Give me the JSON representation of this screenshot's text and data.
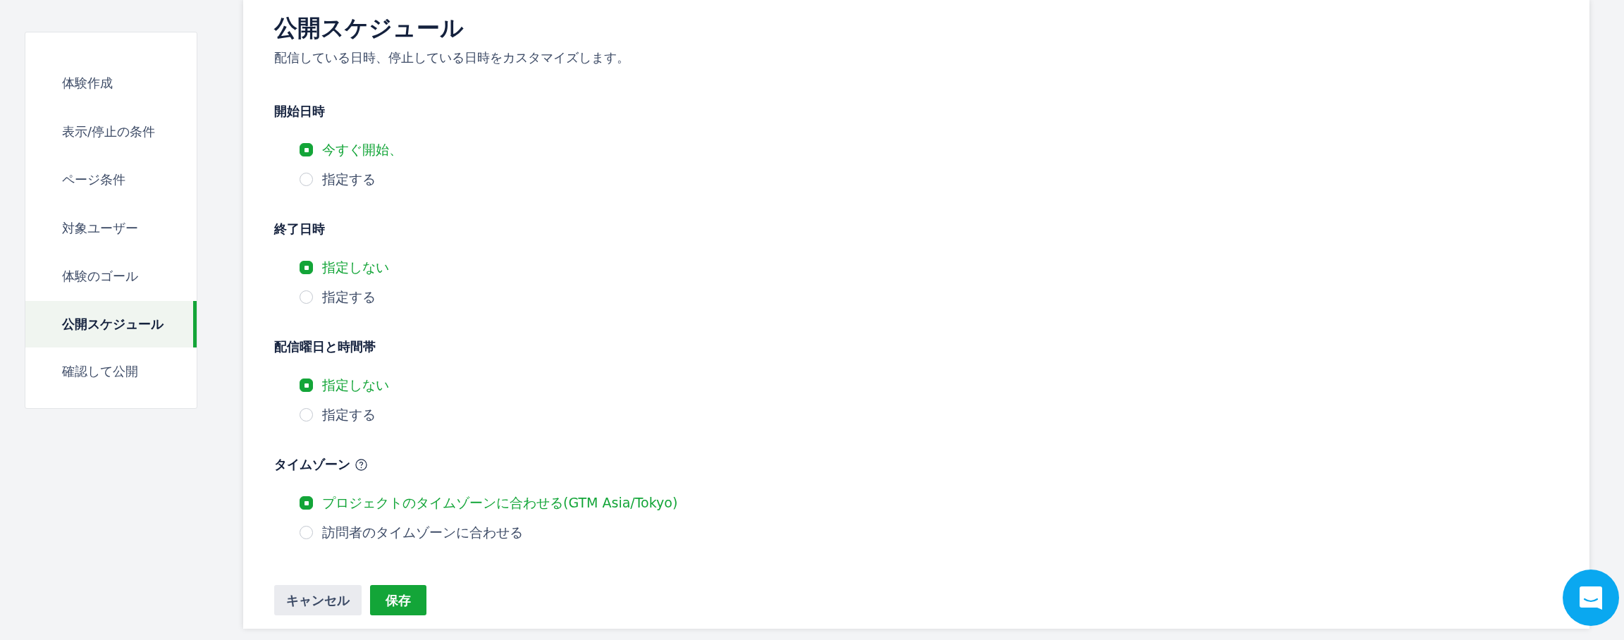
{
  "sidebar": {
    "items": [
      {
        "label": "体験作成",
        "selected": false
      },
      {
        "label": "表示/停止の条件",
        "selected": false
      },
      {
        "label": "ページ条件",
        "selected": false
      },
      {
        "label": "対象ユーザー",
        "selected": false
      },
      {
        "label": "体験のゴール",
        "selected": false
      },
      {
        "label": "公開スケジュール",
        "selected": true
      },
      {
        "label": "確認して公開",
        "selected": false
      }
    ]
  },
  "page": {
    "title": "公開スケジュール",
    "description": "配信している日時、停止している日時をカスタマイズします。"
  },
  "sections": [
    {
      "label": "開始日時",
      "help": false,
      "options": [
        {
          "label": "今すぐ開始、",
          "selected": true
        },
        {
          "label": "指定する",
          "selected": false
        }
      ]
    },
    {
      "label": "終了日時",
      "help": false,
      "options": [
        {
          "label": "指定しない",
          "selected": true
        },
        {
          "label": "指定する",
          "selected": false
        }
      ]
    },
    {
      "label": "配信曜日と時間帯",
      "help": false,
      "options": [
        {
          "label": "指定しない",
          "selected": true
        },
        {
          "label": "指定する",
          "selected": false
        }
      ]
    },
    {
      "label": "タイムゾーン",
      "help": true,
      "options": [
        {
          "label": "プロジェクトのタイムゾーンに合わせる(GTM Asia/Tokyo)",
          "selected": true
        },
        {
          "label": "訪問者のタイムゾーンに合わせる",
          "selected": false
        }
      ]
    }
  ],
  "buttons": [
    {
      "label": "キャンセル",
      "kind": "secondary"
    },
    {
      "label": "保存",
      "kind": "primary"
    }
  ]
}
